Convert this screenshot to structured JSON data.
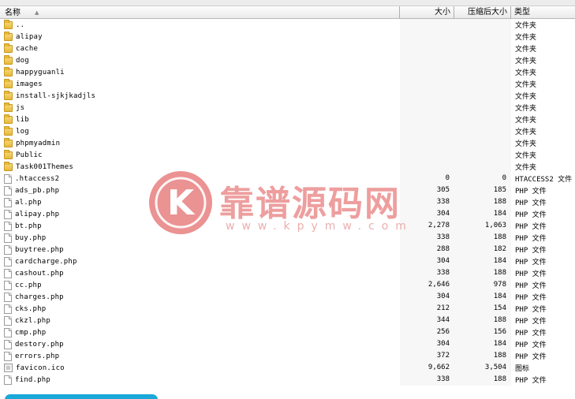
{
  "header": {
    "name_label": "名称",
    "size_label": "大小",
    "compressed_label": "压缩后大小",
    "type_label": "类型"
  },
  "rows": [
    {
      "icon": "folder-icon",
      "name": "..",
      "size": "",
      "compressed": "",
      "type": "文件夹"
    },
    {
      "icon": "folder-icon",
      "name": "alipay",
      "size": "",
      "compressed": "",
      "type": "文件夹"
    },
    {
      "icon": "folder-icon",
      "name": "cache",
      "size": "",
      "compressed": "",
      "type": "文件夹"
    },
    {
      "icon": "folder-icon",
      "name": "dog",
      "size": "",
      "compressed": "",
      "type": "文件夹"
    },
    {
      "icon": "folder-icon",
      "name": "happyguanli",
      "size": "",
      "compressed": "",
      "type": "文件夹"
    },
    {
      "icon": "folder-icon",
      "name": "images",
      "size": "",
      "compressed": "",
      "type": "文件夹"
    },
    {
      "icon": "folder-icon",
      "name": "install-sjkjkadjls",
      "size": "",
      "compressed": "",
      "type": "文件夹"
    },
    {
      "icon": "folder-icon",
      "name": "js",
      "size": "",
      "compressed": "",
      "type": "文件夹"
    },
    {
      "icon": "folder-icon",
      "name": "lib",
      "size": "",
      "compressed": "",
      "type": "文件夹"
    },
    {
      "icon": "folder-icon",
      "name": "log",
      "size": "",
      "compressed": "",
      "type": "文件夹"
    },
    {
      "icon": "folder-icon",
      "name": "phpmyadmin",
      "size": "",
      "compressed": "",
      "type": "文件夹"
    },
    {
      "icon": "folder-icon",
      "name": "Public",
      "size": "",
      "compressed": "",
      "type": "文件夹"
    },
    {
      "icon": "folder-icon",
      "name": "Task001Themes",
      "size": "",
      "compressed": "",
      "type": "文件夹"
    },
    {
      "icon": "file-icon",
      "name": ".htaccess2",
      "size": "0",
      "compressed": "0",
      "type": "HTACCESS2 文件"
    },
    {
      "icon": "file-icon",
      "name": "ads_pb.php",
      "size": "305",
      "compressed": "185",
      "type": "PHP 文件"
    },
    {
      "icon": "file-icon",
      "name": "al.php",
      "size": "338",
      "compressed": "188",
      "type": "PHP 文件"
    },
    {
      "icon": "file-icon",
      "name": "alipay.php",
      "size": "304",
      "compressed": "184",
      "type": "PHP 文件"
    },
    {
      "icon": "file-icon",
      "name": "bt.php",
      "size": "2,278",
      "compressed": "1,063",
      "type": "PHP 文件"
    },
    {
      "icon": "file-icon",
      "name": "buy.php",
      "size": "338",
      "compressed": "188",
      "type": "PHP 文件"
    },
    {
      "icon": "file-icon",
      "name": "buytree.php",
      "size": "288",
      "compressed": "182",
      "type": "PHP 文件"
    },
    {
      "icon": "file-icon",
      "name": "cardcharge.php",
      "size": "304",
      "compressed": "184",
      "type": "PHP 文件"
    },
    {
      "icon": "file-icon",
      "name": "cashout.php",
      "size": "338",
      "compressed": "188",
      "type": "PHP 文件"
    },
    {
      "icon": "file-icon",
      "name": "cc.php",
      "size": "2,646",
      "compressed": "978",
      "type": "PHP 文件"
    },
    {
      "icon": "file-icon",
      "name": "charges.php",
      "size": "304",
      "compressed": "184",
      "type": "PHP 文件"
    },
    {
      "icon": "file-icon",
      "name": "cks.php",
      "size": "212",
      "compressed": "154",
      "type": "PHP 文件"
    },
    {
      "icon": "file-icon",
      "name": "ckzl.php",
      "size": "344",
      "compressed": "188",
      "type": "PHP 文件"
    },
    {
      "icon": "file-icon",
      "name": "cmp.php",
      "size": "256",
      "compressed": "156",
      "type": "PHP 文件"
    },
    {
      "icon": "file-icon",
      "name": "destory.php",
      "size": "304",
      "compressed": "184",
      "type": "PHP 文件"
    },
    {
      "icon": "file-icon",
      "name": "errors.php",
      "size": "372",
      "compressed": "188",
      "type": "PHP 文件"
    },
    {
      "icon": "favicon-icon",
      "name": "favicon.ico",
      "size": "9,662",
      "compressed": "3,504",
      "type": "图标"
    },
    {
      "icon": "file-icon",
      "name": "find.php",
      "size": "338",
      "compressed": "188",
      "type": "PHP 文件"
    }
  ],
  "watermark": {
    "logo_letter": "K",
    "title": "靠谱源码网",
    "url": "www.kpymw.com"
  },
  "colors": {
    "folder": "#e6b93a",
    "watermark": "#e57373",
    "accent_bar": "#1aa8d8"
  }
}
